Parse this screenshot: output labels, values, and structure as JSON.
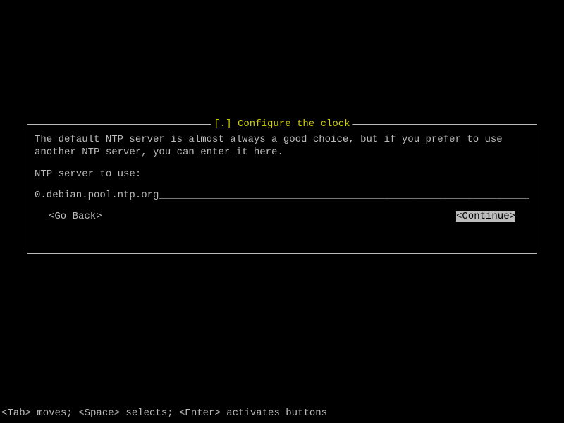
{
  "dialog": {
    "title": "[.] Configure the clock",
    "help_text": "The default NTP server is almost always a good choice, but if you prefer to use another NTP server, you can enter it here.",
    "prompt": "NTP server to use:",
    "input_value": "0.debian.pool.ntp.org",
    "input_fill": "_______________________________________________________________",
    "go_back": "<Go Back>",
    "continue": "<Continue>"
  },
  "footer": {
    "hint": "<Tab> moves; <Space> selects; <Enter> activates buttons"
  }
}
